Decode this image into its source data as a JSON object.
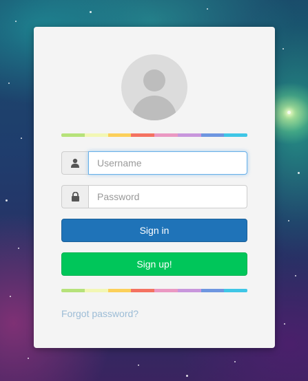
{
  "login_form": {
    "username": {
      "value": "",
      "placeholder": "Username"
    },
    "password": {
      "value": "",
      "placeholder": "Password"
    },
    "sign_in_label": "Sign in",
    "sign_up_label": "Sign up!",
    "forgot_password_label": "Forgot password?"
  },
  "icons": {
    "avatar": "user-avatar-icon",
    "username": "user-icon",
    "password": "lock-icon"
  },
  "colors": {
    "card_background": "#f4f4f4",
    "sign_in": "#1f73b8",
    "sign_up": "#00c65a",
    "link": "#9cbcd6",
    "focus_border": "#66afe9",
    "rainbow_stripe": [
      "#b6e27a",
      "#f2f7b4",
      "#fcd05a",
      "#f47261",
      "#ea98c2",
      "#c896dc",
      "#6e96e0",
      "#3fc6e6"
    ]
  }
}
